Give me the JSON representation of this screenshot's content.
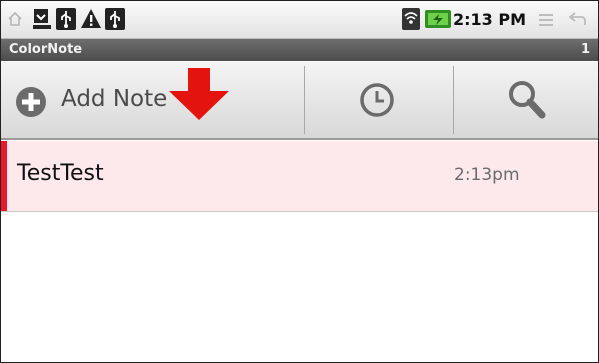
{
  "status_bar": {
    "time": "2:13 PM",
    "icons": [
      "home-icon",
      "download-icon",
      "usb-icon",
      "warning-icon",
      "usb-icon",
      "wifi-icon",
      "battery-charging-icon",
      "menu-icon",
      "back-icon"
    ]
  },
  "title_bar": {
    "app_name": "ColorNote",
    "note_count": "1"
  },
  "toolbar": {
    "add_label": "Add Note",
    "add_icon": "plus-circle-icon",
    "history_icon": "clock-icon",
    "search_icon": "search-icon",
    "pointer_icon": "red-arrow-down-icon"
  },
  "notes": [
    {
      "title": "TestTest",
      "time": "2:13pm",
      "color": "#e8192c",
      "background": "#fde9ec"
    }
  ],
  "colors": {
    "note_red": "#e8192c",
    "note_pink_bg": "#fde9ec",
    "title_bar": "#5a5a5a",
    "arrow_red": "#e3130f"
  }
}
